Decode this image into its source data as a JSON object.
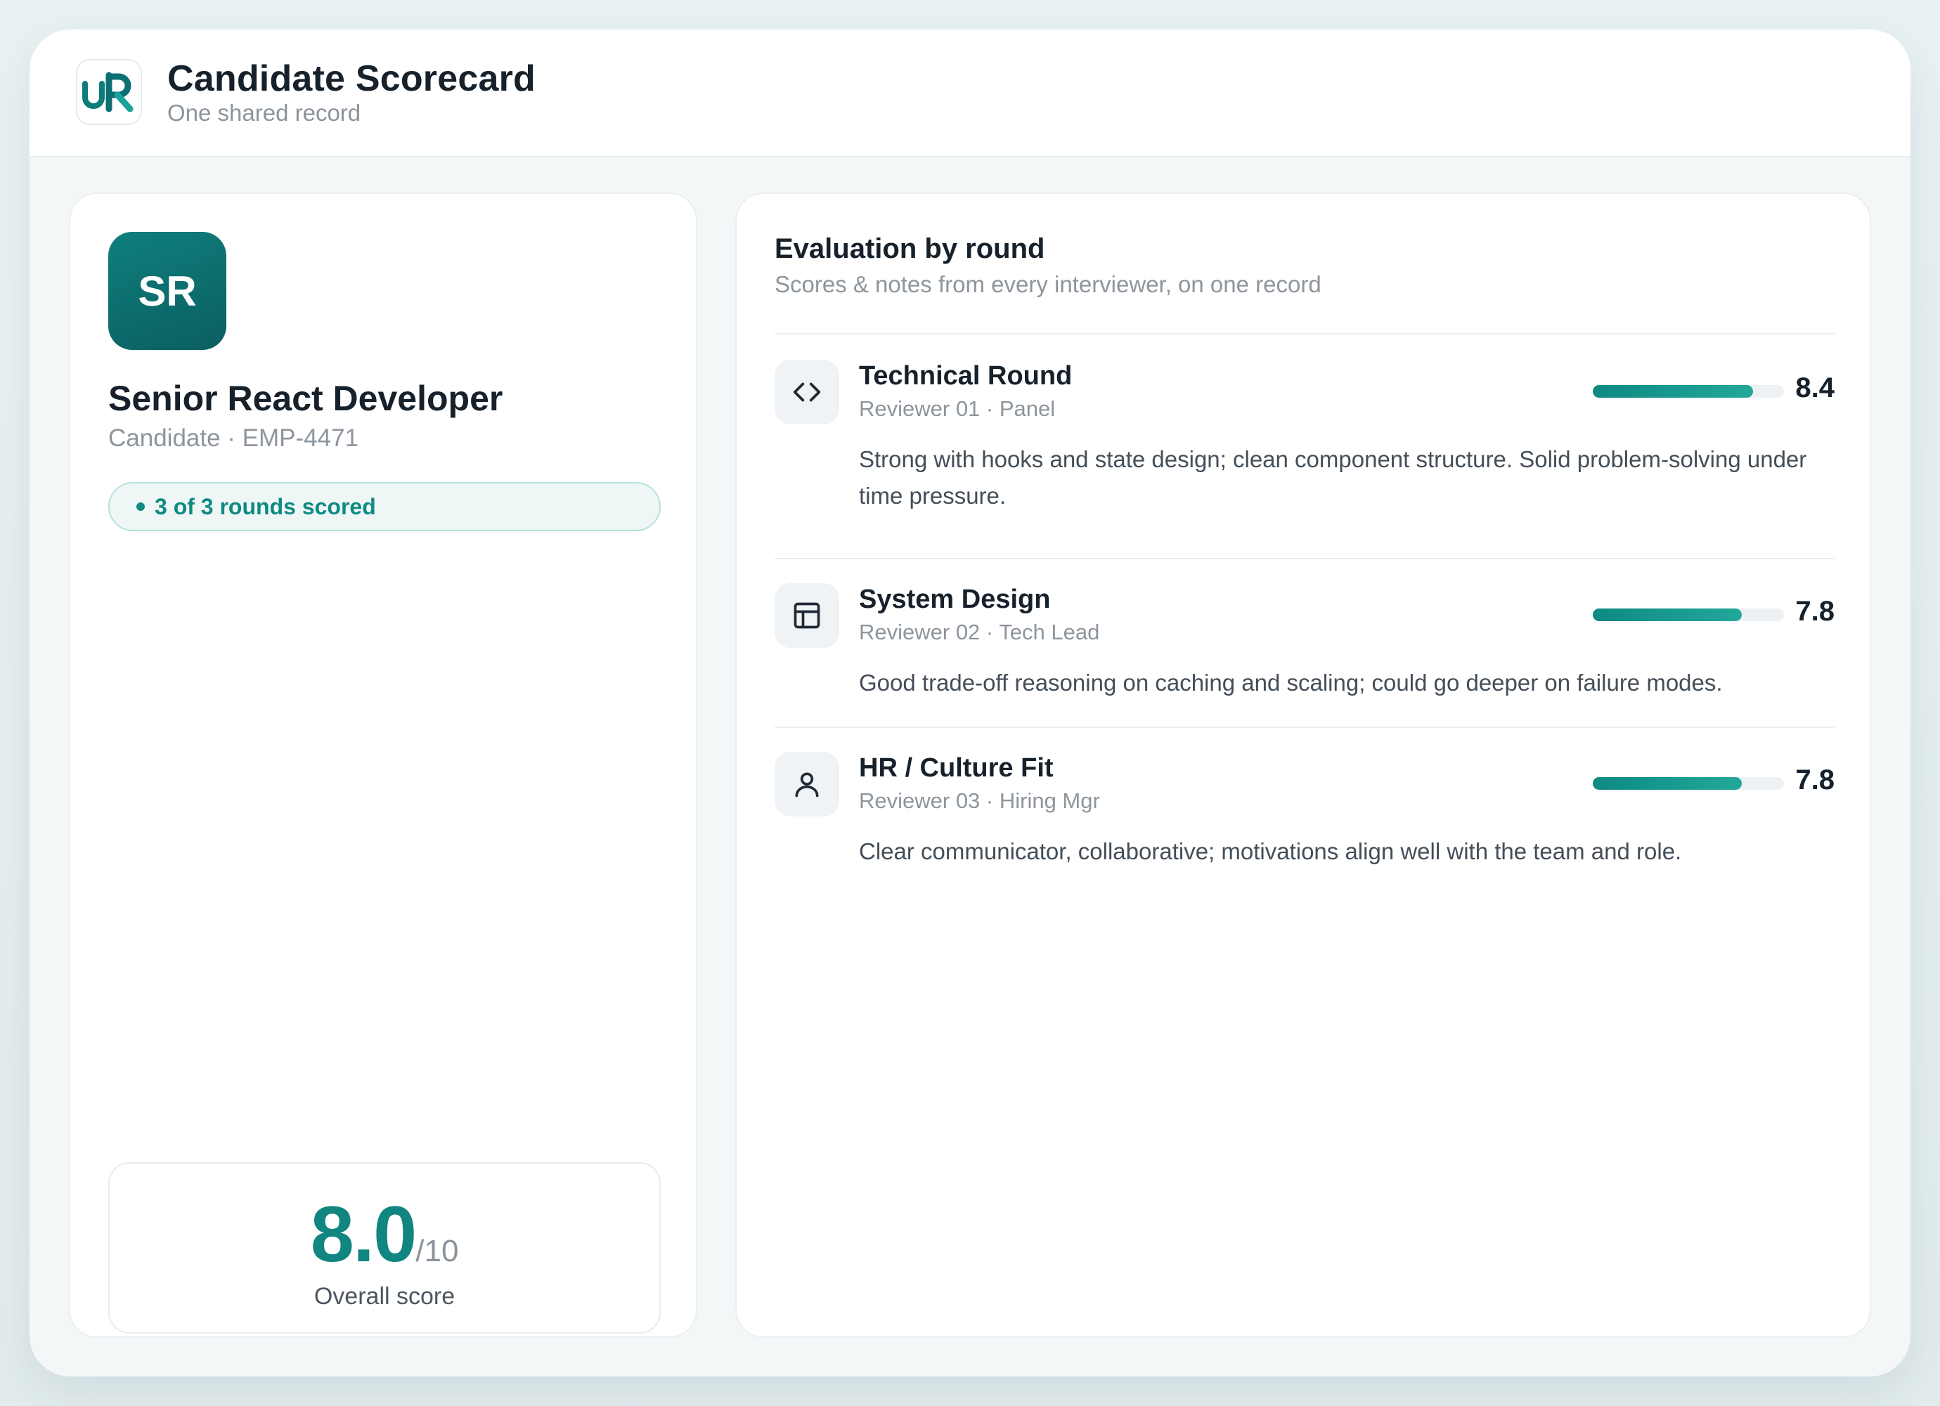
{
  "header": {
    "title": "Candidate Scorecard",
    "subtitle": "One shared record",
    "logo_icon": "ur-logo-icon"
  },
  "candidate": {
    "initials": "SR",
    "title": "Senior React Developer",
    "subtitle": "Candidate · EMP-4471",
    "badge": "3 of 3 rounds scored"
  },
  "overall": {
    "score": "8.0",
    "denominator": "/10",
    "label": "Overall score"
  },
  "evaluation": {
    "title": "Evaluation by round",
    "subtitle": "Scores & notes from every interviewer, on one record",
    "rounds": [
      {
        "name": "Technical Round",
        "reviewer": "Reviewer 01 · Panel",
        "score": "8.4",
        "score_value": 8.4,
        "icon": "code-icon",
        "note": "Strong with hooks and state design; clean component structure. Solid problem-solving under time pressure."
      },
      {
        "name": "System Design",
        "reviewer": "Reviewer 02 · Tech Lead",
        "score": "7.8",
        "score_value": 7.8,
        "icon": "layout-icon",
        "note": "Good trade-off reasoning on caching and scaling; could go deeper on failure modes."
      },
      {
        "name": "HR / Culture Fit",
        "reviewer": "Reviewer 03 · Hiring Mgr",
        "score": "7.8",
        "score_value": 7.8,
        "icon": "user-icon",
        "note": "Clear communicator, collaborative; motivations align well with the team and role."
      }
    ]
  },
  "colors": {
    "accent": "#0f8a82",
    "avatar": "#0f7f7d"
  }
}
